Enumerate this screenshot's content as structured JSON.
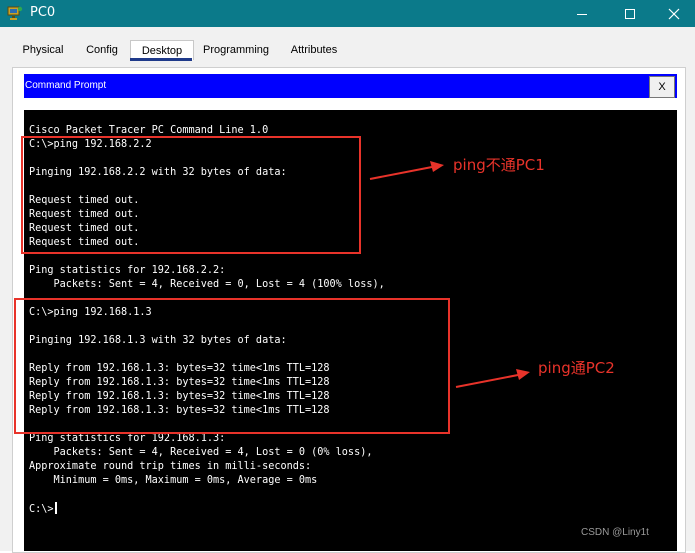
{
  "window": {
    "title": "PC0",
    "minimize_icon": "minimize-icon",
    "maximize_icon": "maximize-icon",
    "close_icon": "close-icon"
  },
  "tabs": [
    {
      "label": "Physical"
    },
    {
      "label": "Config"
    },
    {
      "label": "Desktop",
      "active": true
    },
    {
      "label": "Programming"
    },
    {
      "label": "Attributes"
    }
  ],
  "command_prompt": {
    "title": "Command Prompt",
    "close_label": "X",
    "lines": [
      "Cisco Packet Tracer PC Command Line 1.0",
      "C:\\>ping 192.168.2.2",
      "",
      "Pinging 192.168.2.2 with 32 bytes of data:",
      "",
      "Request timed out.",
      "Request timed out.",
      "Request timed out.",
      "Request timed out.",
      "",
      "Ping statistics for 192.168.2.2:",
      "    Packets: Sent = 4, Received = 0, Lost = 4 (100% loss),",
      "",
      "C:\\>ping 192.168.1.3",
      "",
      "Pinging 192.168.1.3 with 32 bytes of data:",
      "",
      "Reply from 192.168.1.3: bytes=32 time<1ms TTL=128",
      "Reply from 192.168.1.3: bytes=32 time<1ms TTL=128",
      "Reply from 192.168.1.3: bytes=32 time<1ms TTL=128",
      "Reply from 192.168.1.3: bytes=32 time<1ms TTL=128",
      "",
      "Ping statistics for 192.168.1.3:",
      "    Packets: Sent = 4, Received = 4, Lost = 0 (0% loss),",
      "Approximate round trip times in milli-seconds:",
      "    Minimum = 0ms, Maximum = 0ms, Average = 0ms",
      ""
    ],
    "prompt": "C:\\>"
  },
  "annotations": {
    "label1": "ping不通PC1",
    "label2": "ping通PC2",
    "color": "#e8332a"
  },
  "watermark": "CSDN @Liny1t",
  "colors": {
    "titlebar": "#0b7a8a",
    "cmd_header": "#0000ff",
    "terminal_bg": "#000000",
    "tab_active_underline": "#1f3a8a"
  }
}
